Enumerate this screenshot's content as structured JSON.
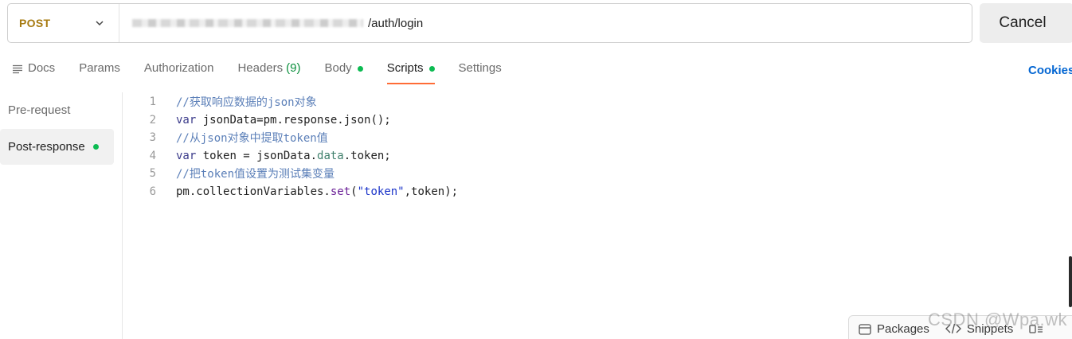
{
  "request": {
    "method": "POST",
    "url_path": "/auth/login",
    "cancel_label": "Cancel"
  },
  "tabs": [
    {
      "label": "Docs"
    },
    {
      "label": "Params"
    },
    {
      "label": "Authorization"
    },
    {
      "label": "Headers",
      "count": "(9)"
    },
    {
      "label": "Body"
    },
    {
      "label": "Scripts"
    },
    {
      "label": "Settings"
    }
  ],
  "cookies_label": "Cookies",
  "sidebar": {
    "items": [
      {
        "label": "Pre-request"
      },
      {
        "label": "Post-response"
      }
    ]
  },
  "editor": {
    "line_numbers": [
      "1",
      "2",
      "3",
      "4",
      "5",
      "6"
    ],
    "lines": [
      {
        "comment": "//获取响应数据的json对象"
      },
      {
        "kw": "var",
        "rest": " jsonData=pm.response.json();"
      },
      {
        "comment": "//从json对象中提取token值"
      },
      {
        "kw": "var",
        "a": " token = jsonData.",
        "prop": "data",
        "b": ".token;"
      },
      {
        "comment": "//把token值设置为测试集变量"
      },
      {
        "a": "pm.collectionVariables.",
        "fn": "set",
        "b": "(",
        "str": "\"token\"",
        "c": ",token);"
      }
    ]
  },
  "bottom_bar": {
    "packages_label": "Packages",
    "snippets_label": "Snippets"
  },
  "watermark": "CSDN @Wpa.wk",
  "colors": {
    "method": "#a77b12",
    "active_tab_underline": "#ff6c37",
    "status_dot": "#0cbb52",
    "cookies_link": "#0265d2"
  }
}
